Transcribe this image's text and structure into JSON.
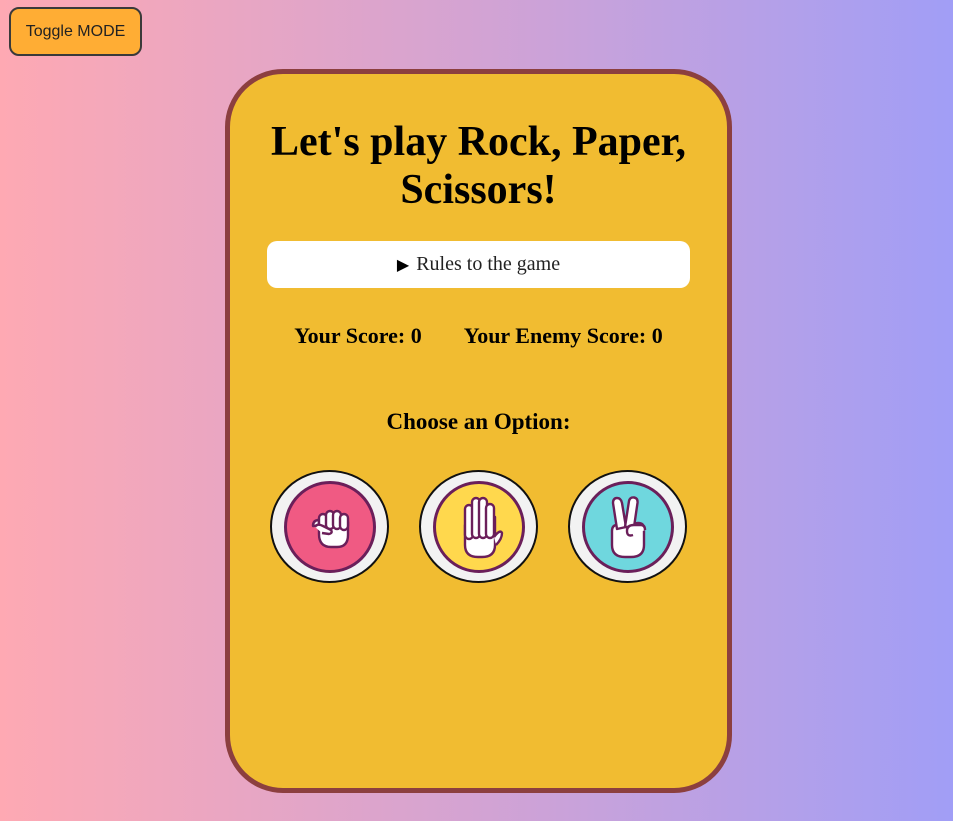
{
  "header": {
    "toggle_label": "Toggle MODE"
  },
  "game": {
    "title": "Let's play Rock, Paper, Scissors!",
    "rules_label": "Rules to the game",
    "your_score_label": "Your Score: 0",
    "enemy_score_label": "Your Enemy Score: 0",
    "choose_label": "Choose an Option:",
    "options": [
      {
        "name": "rock",
        "icon": "fist-icon",
        "color": "#f05a83"
      },
      {
        "name": "paper",
        "icon": "open-hand-icon",
        "color": "#ffd84d"
      },
      {
        "name": "scissors",
        "icon": "peace-hand-icon",
        "color": "#6fd7de"
      }
    ]
  },
  "colors": {
    "background_left": "#fea9b3",
    "background_right": "#a19ef6",
    "card": "#f1bc31",
    "card_border": "#8c3f3f",
    "toggle": "#ffad34"
  }
}
